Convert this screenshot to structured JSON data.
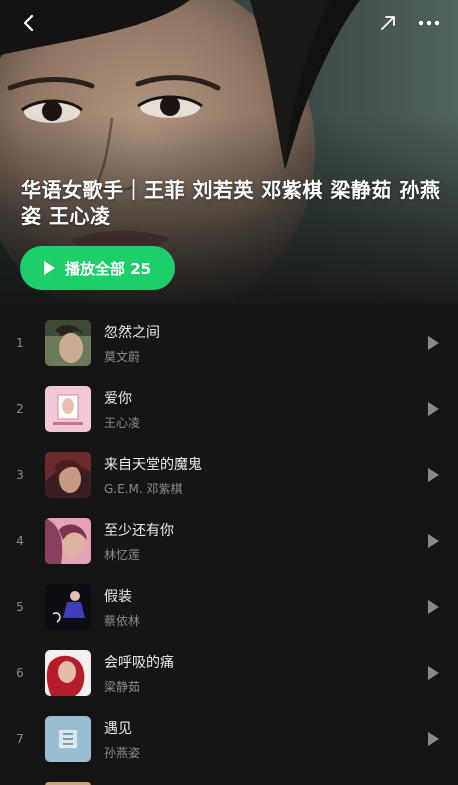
{
  "header": {
    "title": "华语女歌手｜王菲 刘若英 邓紫棋 梁静茹 孙燕姿 王心凌",
    "back_icon": "chevron-left-icon",
    "share_icon": "share-arrow-icon",
    "more_icon": "more-dots-icon"
  },
  "play_all": {
    "label": "播放全部",
    "count": "25"
  },
  "colors": {
    "accent": "#1ece6b",
    "background": "#151515"
  },
  "songs": [
    {
      "index": "1",
      "title": "忽然之间",
      "artist": "莫文蔚"
    },
    {
      "index": "2",
      "title": "爱你",
      "artist": "王心凌"
    },
    {
      "index": "3",
      "title": "来自天堂的魔鬼",
      "artist": "G.E.M. 邓紫棋"
    },
    {
      "index": "4",
      "title": "至少还有你",
      "artist": "林忆莲"
    },
    {
      "index": "5",
      "title": "假装",
      "artist": "蔡依林"
    },
    {
      "index": "6",
      "title": "会呼吸的痛",
      "artist": "梁静茹"
    },
    {
      "index": "7",
      "title": "遇见",
      "artist": "孙燕姿"
    }
  ]
}
